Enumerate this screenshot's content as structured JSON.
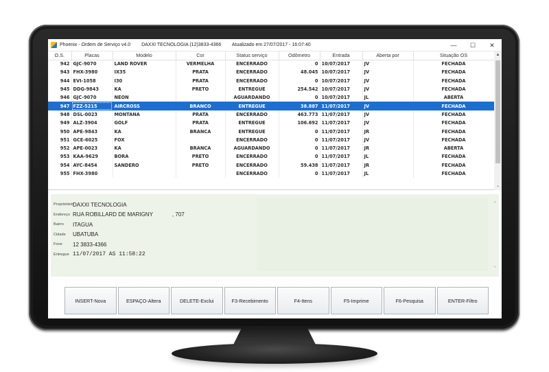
{
  "window": {
    "title": "Phoenix - Ordem de Serviço v4.0",
    "company": "DAXXI TECNOLOGIA (12)3833-4366",
    "updated": "Atualizado em 27/07/2017 - 16:07:40",
    "minimize": "—",
    "maximize": "☐",
    "close": "✕"
  },
  "grid": {
    "columns": [
      "O.S.",
      "Placas",
      "Modelo",
      "Cor",
      "Status serviço",
      "Odômetro",
      "Entrada",
      "Aberta por",
      "Situação OS"
    ],
    "rows": [
      {
        "os": "942",
        "placa": "GJC-9070",
        "modelo": "LAND ROVER",
        "cor": "VERMELHA",
        "status": "ENCERRADO",
        "odometro": "0",
        "entrada": "10/07/2017",
        "aberta": "JV",
        "situacao": "FECHADA"
      },
      {
        "os": "943",
        "placa": "FHX-3980",
        "modelo": "IX35",
        "cor": "PRATA",
        "status": "ENCERRADO",
        "odometro": "48.045",
        "entrada": "10/07/2017",
        "aberta": "JV",
        "situacao": "FECHADA"
      },
      {
        "os": "944",
        "placa": "EVI-1058",
        "modelo": "I30",
        "cor": "PRATA",
        "status": "ENCERRADO",
        "odometro": "0",
        "entrada": "10/07/2017",
        "aberta": "JV",
        "situacao": "FECHADA"
      },
      {
        "os": "945",
        "placa": "DDG-9843",
        "modelo": "KA",
        "cor": "PRETO",
        "status": "ENTREGUE",
        "odometro": "254.542",
        "entrada": "10/07/2017",
        "aberta": "JV",
        "situacao": "FECHADA"
      },
      {
        "os": "946",
        "placa": "GJC-9070",
        "modelo": "NEON",
        "cor": "",
        "status": "AGUARDANDO",
        "odometro": "0",
        "entrada": "10/07/2017",
        "aberta": "JL",
        "situacao": "ABERTA"
      },
      {
        "os": "947",
        "placa": "FZZ-5215",
        "modelo": "AIRCROSS",
        "cor": "BRANCO",
        "status": "ENTREGUE",
        "odometro": "38.887",
        "entrada": "11/07/2017",
        "aberta": "JV",
        "situacao": "FECHADA"
      },
      {
        "os": "948",
        "placa": "DSL-0023",
        "modelo": "MONTANA",
        "cor": "PRATA",
        "status": "ENCERRADO",
        "odometro": "463.773",
        "entrada": "11/07/2017",
        "aberta": "JV",
        "situacao": "FECHADA"
      },
      {
        "os": "949",
        "placa": "ALZ-3904",
        "modelo": "GOLF",
        "cor": "PRATA",
        "status": "ENTREGUE",
        "odometro": "106.692",
        "entrada": "11/07/2017",
        "aberta": "JV",
        "situacao": "FECHADA"
      },
      {
        "os": "950",
        "placa": "APE-9843",
        "modelo": "KA",
        "cor": "BRANCA",
        "status": "ENTREGUE",
        "odometro": "0",
        "entrada": "11/07/2017",
        "aberta": "JR",
        "situacao": "FECHADA"
      },
      {
        "os": "951",
        "placa": "GCE-6025",
        "modelo": "FOX",
        "cor": "",
        "status": "ENCERRADO",
        "odometro": "0",
        "entrada": "11/07/2017",
        "aberta": "JV",
        "situacao": "FECHADA"
      },
      {
        "os": "952",
        "placa": "APE-0023",
        "modelo": "KA",
        "cor": "BRANCA",
        "status": "AGUARDANDO",
        "odometro": "0",
        "entrada": "11/07/2017",
        "aberta": "JR",
        "situacao": "ABERTA"
      },
      {
        "os": "953",
        "placa": "KAA-9629",
        "modelo": "BORA",
        "cor": "PRETO",
        "status": "ENCERRADO",
        "odometro": "0",
        "entrada": "11/07/2017",
        "aberta": "JL",
        "situacao": "FECHADA"
      },
      {
        "os": "954",
        "placa": "AYC-8454",
        "modelo": "SANDERO",
        "cor": "PRETO",
        "status": "ENCERRADO",
        "odometro": "59.438",
        "entrada": "11/07/2017",
        "aberta": "JR",
        "situacao": "FECHADA"
      },
      {
        "os": "955",
        "placa": "FHX-3980",
        "modelo": "",
        "cor": "",
        "status": "ENCERRADO",
        "odometro": "0",
        "entrada": "11/07/2017",
        "aberta": "JL",
        "situacao": "FECHADA"
      }
    ],
    "selected_os": "947",
    "scroll_up": "▲",
    "scroll_down": "⌄"
  },
  "detail": {
    "proprietario_label": "Proprietário",
    "proprietario": "DAXXI TECNOLOGIA",
    "endereco_label": "Endereço",
    "endereco": "RUA ROBILLARD DE MARIGNY",
    "numero": ", 707",
    "bairro_label": "Bairro",
    "bairro": "ITAGUA",
    "cidade_label": "Cidade",
    "cidade": "UBATUBA",
    "fone_label": "Fone",
    "fone": "12   3833-4366",
    "entregue_label": "Entregue",
    "entregue": "11/07/2017 AS 11:58:22",
    "scroll_up": "˄",
    "scroll_down": "˅"
  },
  "buttons": [
    "INSERT-Nova",
    "ESPAÇO-Altera",
    "DELETE-Exclui",
    "F3-Recebimento",
    "F4-Itens",
    "F5-Imprime",
    "F6-Pesquisa",
    "ENTER-Filtro"
  ],
  "colors": {
    "selection": "#1c6fd1",
    "detail_bg": "#eef3ea"
  }
}
